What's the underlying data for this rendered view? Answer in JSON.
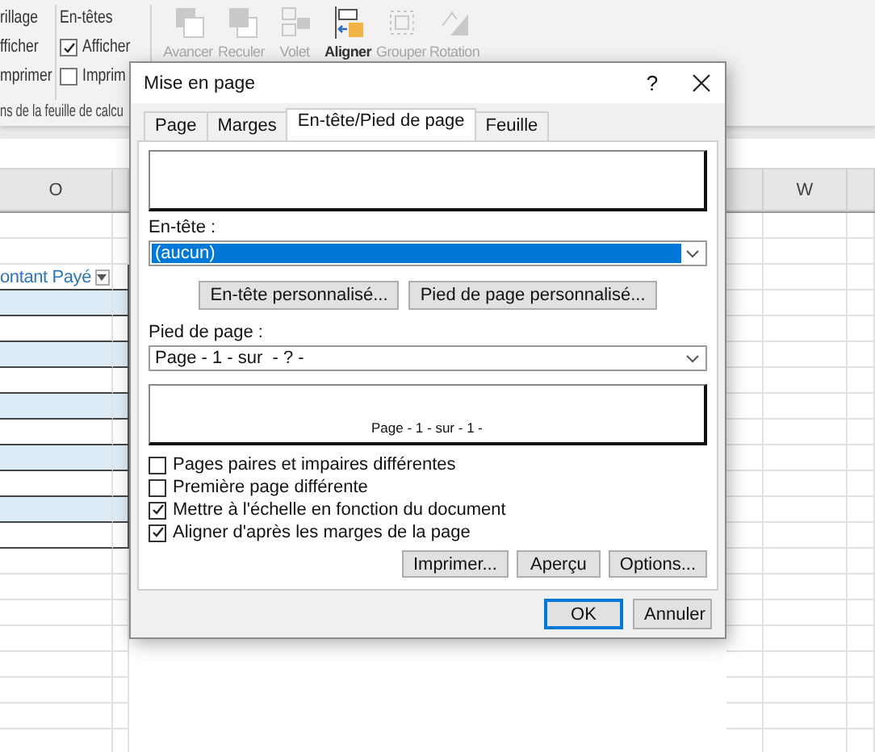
{
  "ribbon": {
    "gridlines": {
      "title": "rillage",
      "options": [
        "fficher",
        "mprimer"
      ]
    },
    "headings": {
      "title": "En-têtes",
      "options": [
        {
          "label": "Afficher",
          "checked": true
        },
        {
          "label": "Imprim",
          "checked": false
        }
      ]
    },
    "group_label": "ns de la feuille de calcu",
    "arrange": [
      {
        "label": "Avancer",
        "disabled": true
      },
      {
        "label": "Reculer",
        "disabled": true
      },
      {
        "label": "Volet",
        "disabled": true
      },
      {
        "label": "Aligner",
        "disabled": false
      },
      {
        "label": "Grouper",
        "disabled": true
      },
      {
        "label": "Rotation",
        "disabled": true
      }
    ]
  },
  "sheet": {
    "columns": [
      {
        "label": "O"
      },
      {
        "label": "W"
      }
    ],
    "table_header": "ontant Payé"
  },
  "dialog": {
    "title": "Mise en page",
    "help": "?",
    "tabs": [
      {
        "label": "Page",
        "selected": false
      },
      {
        "label": "Marges",
        "selected": false
      },
      {
        "label": "En-tête/Pied de page",
        "selected": true
      },
      {
        "label": "Feuille",
        "selected": false
      }
    ],
    "header_label": "En-tête :",
    "header_select": {
      "value": "(aucun)",
      "highlighted": true
    },
    "custom_buttons": [
      "En-tête personnalisé...",
      "Pied de page personnalisé..."
    ],
    "footer_label": "Pied de page :",
    "footer_select": {
      "value": "Page - 1 - sur  - ? -",
      "highlighted": false
    },
    "footer_preview": "Page - 1 - sur - 1 -",
    "options": [
      {
        "label": "Pages paires et impaires différentes",
        "checked": false
      },
      {
        "label": "Première page différente",
        "checked": false
      },
      {
        "label": "Mettre à l'échelle en fonction du document",
        "checked": true
      },
      {
        "label": "Aligner d'après les marges de la page",
        "checked": true
      }
    ],
    "action_buttons": [
      "Imprimer...",
      "Aperçu",
      "Options..."
    ],
    "buttons": [
      {
        "label": "OK",
        "default": true
      },
      {
        "label": "Annuler",
        "default": false
      }
    ]
  }
}
